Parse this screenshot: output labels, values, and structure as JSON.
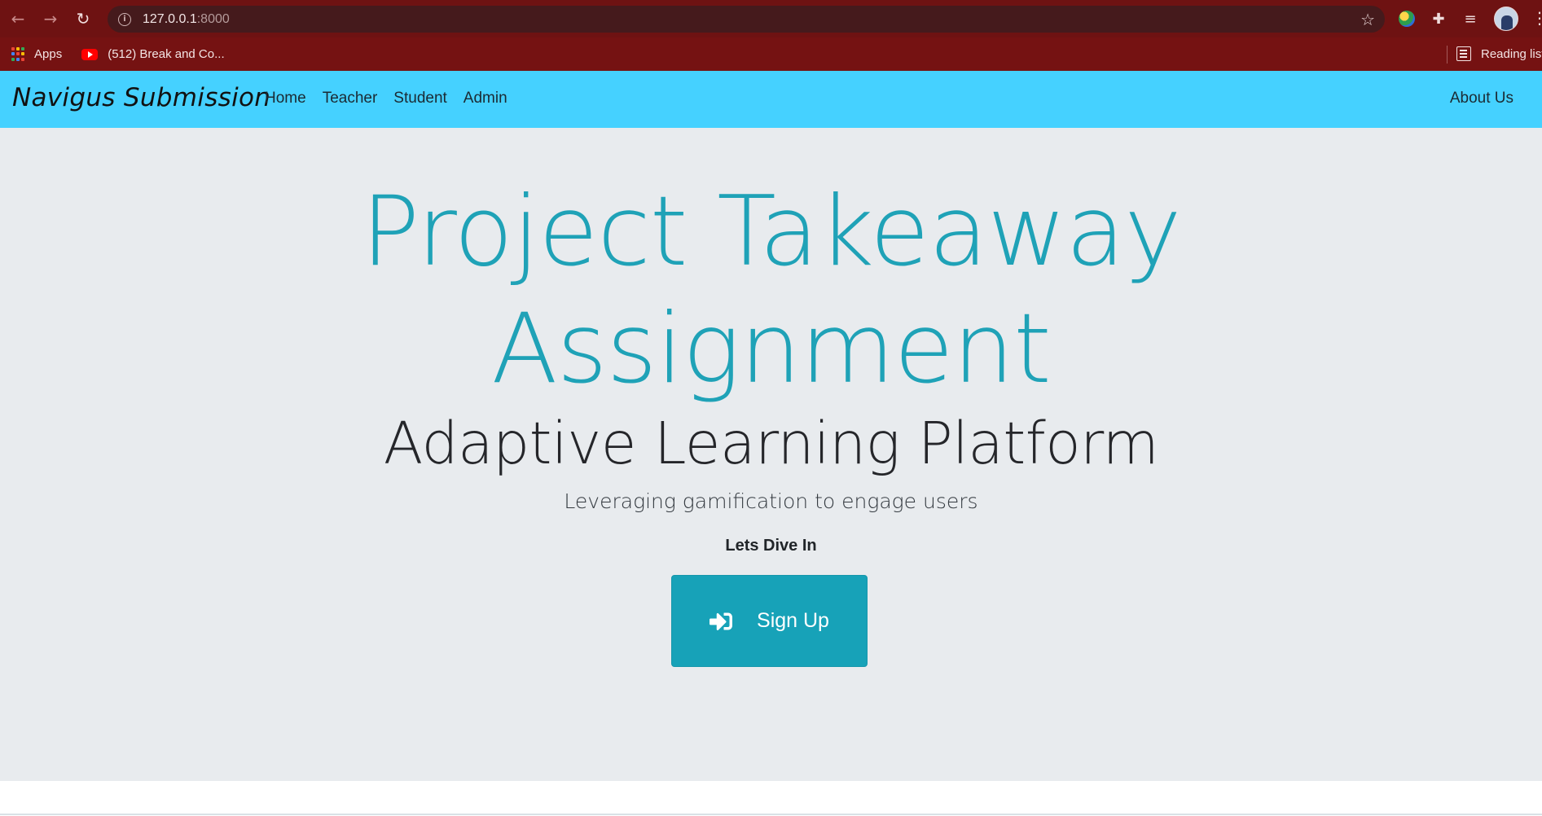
{
  "browser": {
    "url_host": "127.0.0.1",
    "url_port": ":8000",
    "bookmarks": [
      {
        "label": "Apps",
        "icon": "apps-grid-icon"
      },
      {
        "label": "(512) Break and Co...",
        "icon": "youtube-icon"
      }
    ],
    "reading_list_label": "Reading list",
    "icons": [
      "back-arrow-icon",
      "forward-arrow-icon",
      "reload-icon",
      "info-icon",
      "star-icon",
      "extension-globe-icon",
      "puzzle-icon",
      "media-queue-icon",
      "profile-avatar",
      "kebab-menu-icon"
    ]
  },
  "navbar": {
    "brand": "Navigus Submission",
    "links": [
      "Home",
      "Teacher",
      "Student",
      "Admin"
    ],
    "right_link": "About Us",
    "background": "#45d1ff"
  },
  "hero": {
    "title_line1": "Project Takeaway",
    "title_line2": "Assignment",
    "subtitle": "Adaptive Learning Platform",
    "lead": "Leveraging gamification to engage users",
    "cta_label": "Lets Dive In",
    "button_label": "Sign Up",
    "button_icon": "sign-in-icon",
    "accent_color": "#17a2b8",
    "background": "#e8ebee"
  }
}
